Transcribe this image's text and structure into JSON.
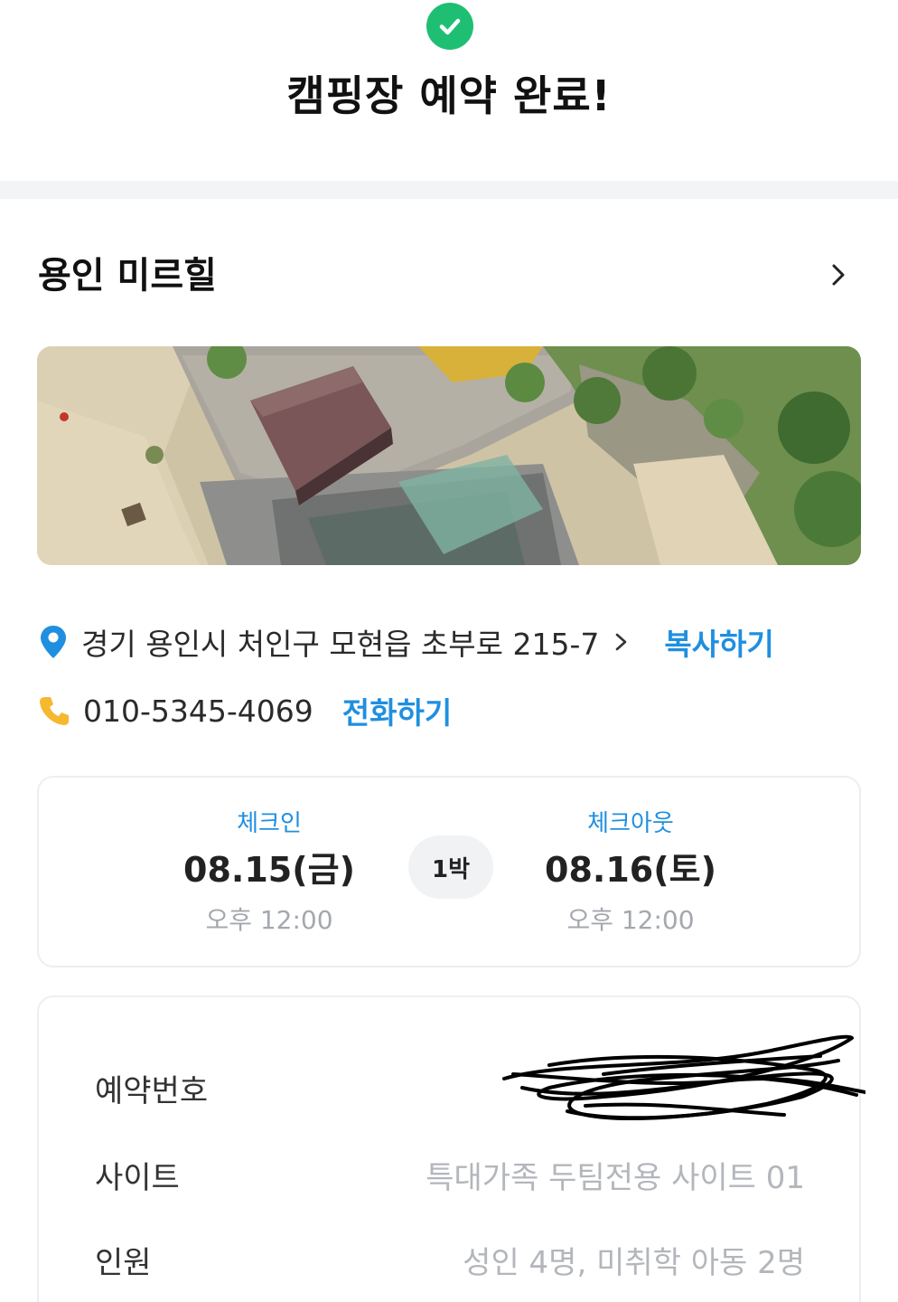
{
  "header": {
    "title": "캠핑장 예약 완료!"
  },
  "campsite": {
    "name": "용인 미르힐",
    "address": "경기 용인시 처인구 모현읍 초부로 215-7",
    "copy_label": "복사하기",
    "phone": "010-5345-4069",
    "call_label": "전화하기"
  },
  "stay": {
    "checkin_label": "체크인",
    "checkin_date": "08.15(금)",
    "checkin_time": "오후 12:00",
    "nights": "1박",
    "checkout_label": "체크아웃",
    "checkout_date": "08.16(토)",
    "checkout_time": "오후 12:00"
  },
  "details": {
    "reservation_number_label": "예약번호",
    "site_label": "사이트",
    "site_value": "특대가족 두팀전용 사이트 01",
    "guests_label": "인원",
    "guests_value": "성인 4명, 미취학 아동 2명"
  },
  "colors": {
    "accent": "#1f8fe0",
    "success": "#1fbf73",
    "pin": "#1f8fe0",
    "phone": "#f5b82e"
  },
  "icons": [
    "check-circle-icon",
    "chevron-right-icon",
    "location-pin-icon",
    "phone-icon"
  ]
}
